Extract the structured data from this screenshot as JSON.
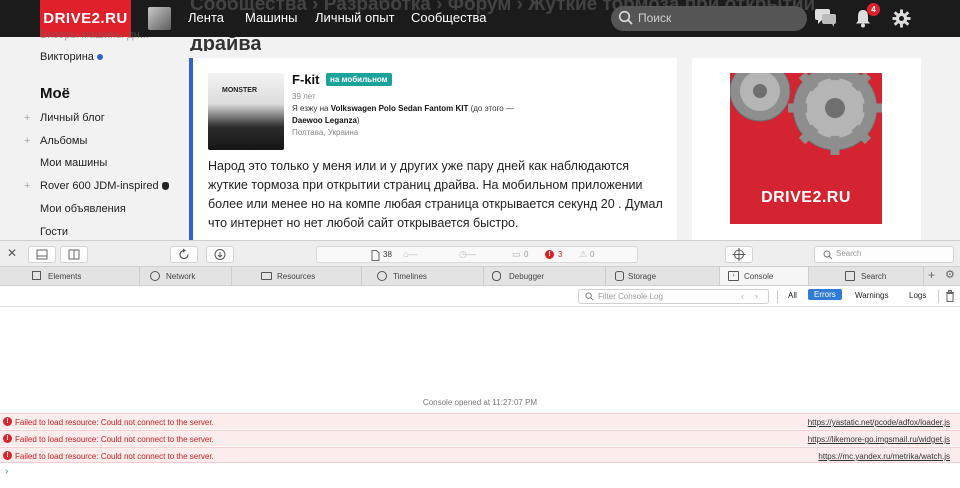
{
  "site": {
    "logo": "DRIVE2.RU",
    "nav": [
      "Лента",
      "Машины",
      "Личный опыт",
      "Сообщества"
    ],
    "breadcrumb_bg": "Сообщества › Разработка › Форум › Жуткие тормоза при открытии",
    "search_placeholder": "Поиск",
    "notification_count": "4"
  },
  "sidebar": {
    "top_partial": "Бизоры машины дн...",
    "items_top": [
      "Викторина"
    ],
    "section_title": "Моё",
    "items": [
      {
        "label": "Личный блог",
        "plus": true
      },
      {
        "label": "Альбомы",
        "plus": true
      },
      {
        "label": "Мои машины",
        "plus": false
      },
      {
        "label": "Rover 600 JDM-inspired",
        "plus": true
      },
      {
        "label": "Мои объявления",
        "plus": false
      },
      {
        "label": "Гости",
        "plus": false
      }
    ]
  },
  "page": {
    "title_bg": "драйва"
  },
  "post": {
    "author": "F-kit",
    "badge": "на мобильном",
    "age": "39 лет",
    "car_prefix": "Я езжу на ",
    "car": "Volkswagen Polo Sedan Fantom KIT",
    "car_prev_prefix": " (до этого — ",
    "car_prev": "Daewoo Leganza",
    "car_prev_suffix": ")",
    "location": "Полтава, Украина",
    "photo_caption": "MONSTER",
    "text": "Народ это только у меня или и у других уже пару дней как наблюдаются жуткие тормоза при открытии страниц драйва. На мобильном приложении более или менее но на компе любая страница открывается секунд 20 . Думал что интернет но нет любой сайт открывается быстро."
  },
  "ad": {
    "banner_text": "DRIVE2.RU"
  },
  "devtools": {
    "resource_count": "38",
    "log_count": "0",
    "error_count": "3",
    "warning_count": "0",
    "search_placeholder": "Search",
    "tabs": [
      "Elements",
      "Network",
      "Resources",
      "Timelines",
      "Debugger",
      "Storage",
      "Console",
      "Search"
    ],
    "filter_placeholder": "Filter Console Log",
    "filters": [
      "All",
      "Errors",
      "Warnings",
      "Logs"
    ],
    "console_opened": "Console opened at 11:27:07 PM",
    "errors": [
      {
        "message": "Failed to load resource: Could not connect to the server.",
        "source": "https://yastatic.net/pcode/adfox/loader.js"
      },
      {
        "message": "Failed to load resource: Could not connect to the server.",
        "source": "https://likemore-go.imgsmail.ru/widget.js"
      },
      {
        "message": "Failed to load resource: Could not connect to the server.",
        "source": "https://mc.yandex.ru/metrika/watch.js"
      }
    ],
    "prompt": "›"
  },
  "colors": {
    "brand_red": "#e0202b",
    "post_accent": "#2f63c9",
    "badge_teal": "#1aa39a",
    "error_red": "#d8232a",
    "active_filter": "#2f7bd6"
  }
}
